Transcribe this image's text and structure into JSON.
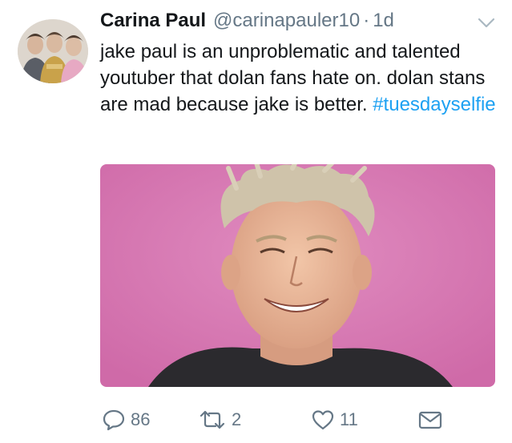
{
  "tweet": {
    "author_name": "Carina Paul",
    "author_handle": "@carinapauler10",
    "separator": "·",
    "time": "1d",
    "text": "jake paul is an unproblematic and talented youtuber that dolan fans hate on. dolan stans are mad because jake is better.",
    "hashtag": "#tuesdayselfie",
    "media_alt": "photo",
    "replies": "86",
    "retweets": "2",
    "likes": "11"
  },
  "icons": {
    "caret": "chevron-down-icon",
    "reply": "reply-icon",
    "retweet": "retweet-icon",
    "like": "heart-icon",
    "dm": "envelope-icon"
  },
  "colors": {
    "text": "#14171a",
    "secondary": "#657786",
    "link": "#1da1f2",
    "photo_background": "#d977b3"
  }
}
